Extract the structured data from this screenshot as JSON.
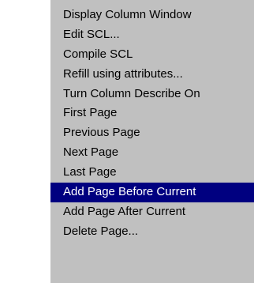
{
  "menu": {
    "items": [
      {
        "label": "Display Column Window",
        "selected": false
      },
      {
        "label": "Edit SCL...",
        "selected": false
      },
      {
        "label": "Compile SCL",
        "selected": false
      },
      {
        "label": "Refill using attributes...",
        "selected": false
      },
      {
        "label": "Turn Column Describe On",
        "selected": false
      },
      {
        "label": "First Page",
        "selected": false
      },
      {
        "label": "Previous Page",
        "selected": false
      },
      {
        "label": "Next Page",
        "selected": false
      },
      {
        "label": "Last Page",
        "selected": false
      },
      {
        "label": "Add Page Before Current",
        "selected": true
      },
      {
        "label": "Add Page After Current",
        "selected": false
      },
      {
        "label": "Delete Page...",
        "selected": false
      }
    ]
  },
  "colors": {
    "menu_background": "#c0c0c0",
    "highlight_background": "#000080",
    "highlight_text": "#ffffff",
    "text": "#000000"
  }
}
